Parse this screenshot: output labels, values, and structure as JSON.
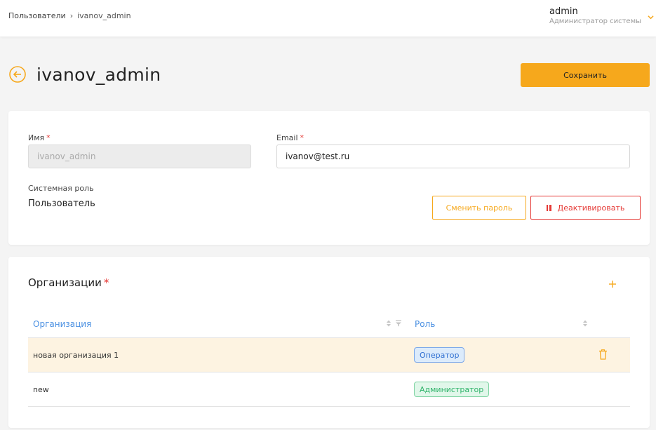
{
  "breadcrumb": {
    "parent": "Пользователи",
    "separator": "›",
    "current": "ivanov_admin"
  },
  "user_menu": {
    "name": "admin",
    "role": "Администратор системы"
  },
  "page": {
    "title": "ivanov_admin",
    "save_label": "Сохранить"
  },
  "form": {
    "name_label": "Имя",
    "name_value": "ivanov_admin",
    "email_label": "Email",
    "email_value": "ivanov@test.ru",
    "required_mark": "*",
    "system_role_label": "Системная роль",
    "system_role_value": "Пользователь",
    "change_password_label": "Сменить пароль",
    "deactivate_label": "Деактивировать"
  },
  "orgs": {
    "title": "Организации",
    "required_mark": "*",
    "columns": {
      "org": "Организация",
      "role": "Роль"
    },
    "rows": [
      {
        "org": "новая организация 1",
        "role": "Оператор"
      },
      {
        "org": "new",
        "role": "Администратор"
      }
    ]
  },
  "colors": {
    "accent": "#f6a81c",
    "danger": "#e53935",
    "link": "#4a90e2"
  },
  "icons": [
    "back-arrow-icon",
    "chevron-down-icon",
    "pause-icon",
    "plus-icon",
    "sort-icon",
    "filter-icon",
    "trash-icon"
  ]
}
